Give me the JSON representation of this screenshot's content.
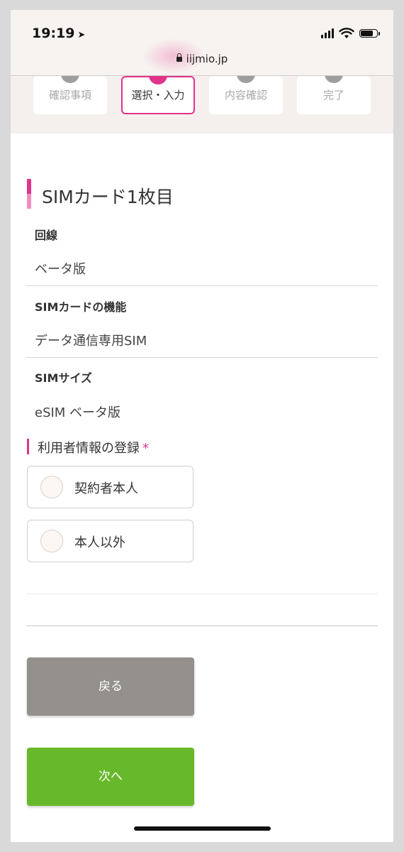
{
  "status_bar": {
    "time": "19:19",
    "location_arrow": "location-arrow-icon",
    "url": "iijmio.jp"
  },
  "steps": [
    {
      "label": "確認事項",
      "active": false
    },
    {
      "label": "選択・入力",
      "active": true
    },
    {
      "label": "内容確認",
      "active": false
    },
    {
      "label": "完了",
      "active": false
    }
  ],
  "sim_card": {
    "heading": "SIMカード1枚目",
    "fields": [
      {
        "label": "回線",
        "value": "ベータ版"
      },
      {
        "label": "SIMカードの機能",
        "value": "データ通信専用SIM"
      },
      {
        "label": "SIMサイズ",
        "value": "eSIM ベータ版"
      }
    ]
  },
  "user_registration": {
    "title": "利用者情報の登録",
    "required_mark": "*",
    "options": [
      "契約者本人",
      "本人以外"
    ]
  },
  "buttons": {
    "back": "戻る",
    "next": "次へ"
  },
  "colors": {
    "accent_pink": "#e0338a",
    "next_green": "#68b82b",
    "back_gray": "#94918c"
  }
}
